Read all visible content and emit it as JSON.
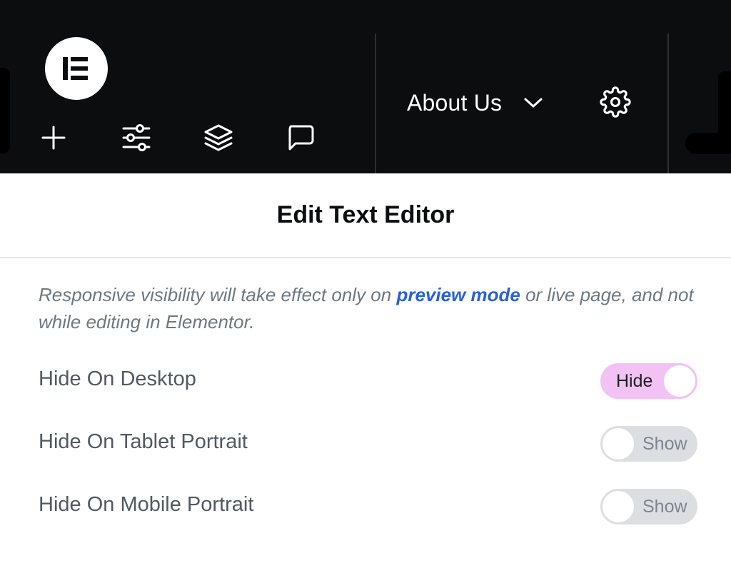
{
  "topbar": {
    "document_title": "About Us",
    "icons": {
      "logo": "elementor-logo-icon",
      "add": "plus-icon",
      "site_settings": "sliders-icon",
      "structure": "layers-icon",
      "notes": "chat-bubble-icon",
      "title_dropdown": "chevron-down-icon",
      "page_settings": "gear-icon"
    }
  },
  "panel": {
    "title": "Edit Text Editor",
    "notice": {
      "before": "Responsive visibility will take effect only on ",
      "link": "preview mode",
      "after": " or live page, and not while editing in Elementor."
    },
    "rows": [
      {
        "label": "Hide On Desktop",
        "state": "Hide"
      },
      {
        "label": "Hide On Tablet Portrait",
        "state": "Show"
      },
      {
        "label": "Hide On Mobile Portrait",
        "state": "Show"
      }
    ]
  },
  "colors": {
    "topbar_bg": "#0c0d0e",
    "toggle_on": "#f2c2f5",
    "toggle_off": "#dcdee1",
    "link": "#2a60d8"
  }
}
